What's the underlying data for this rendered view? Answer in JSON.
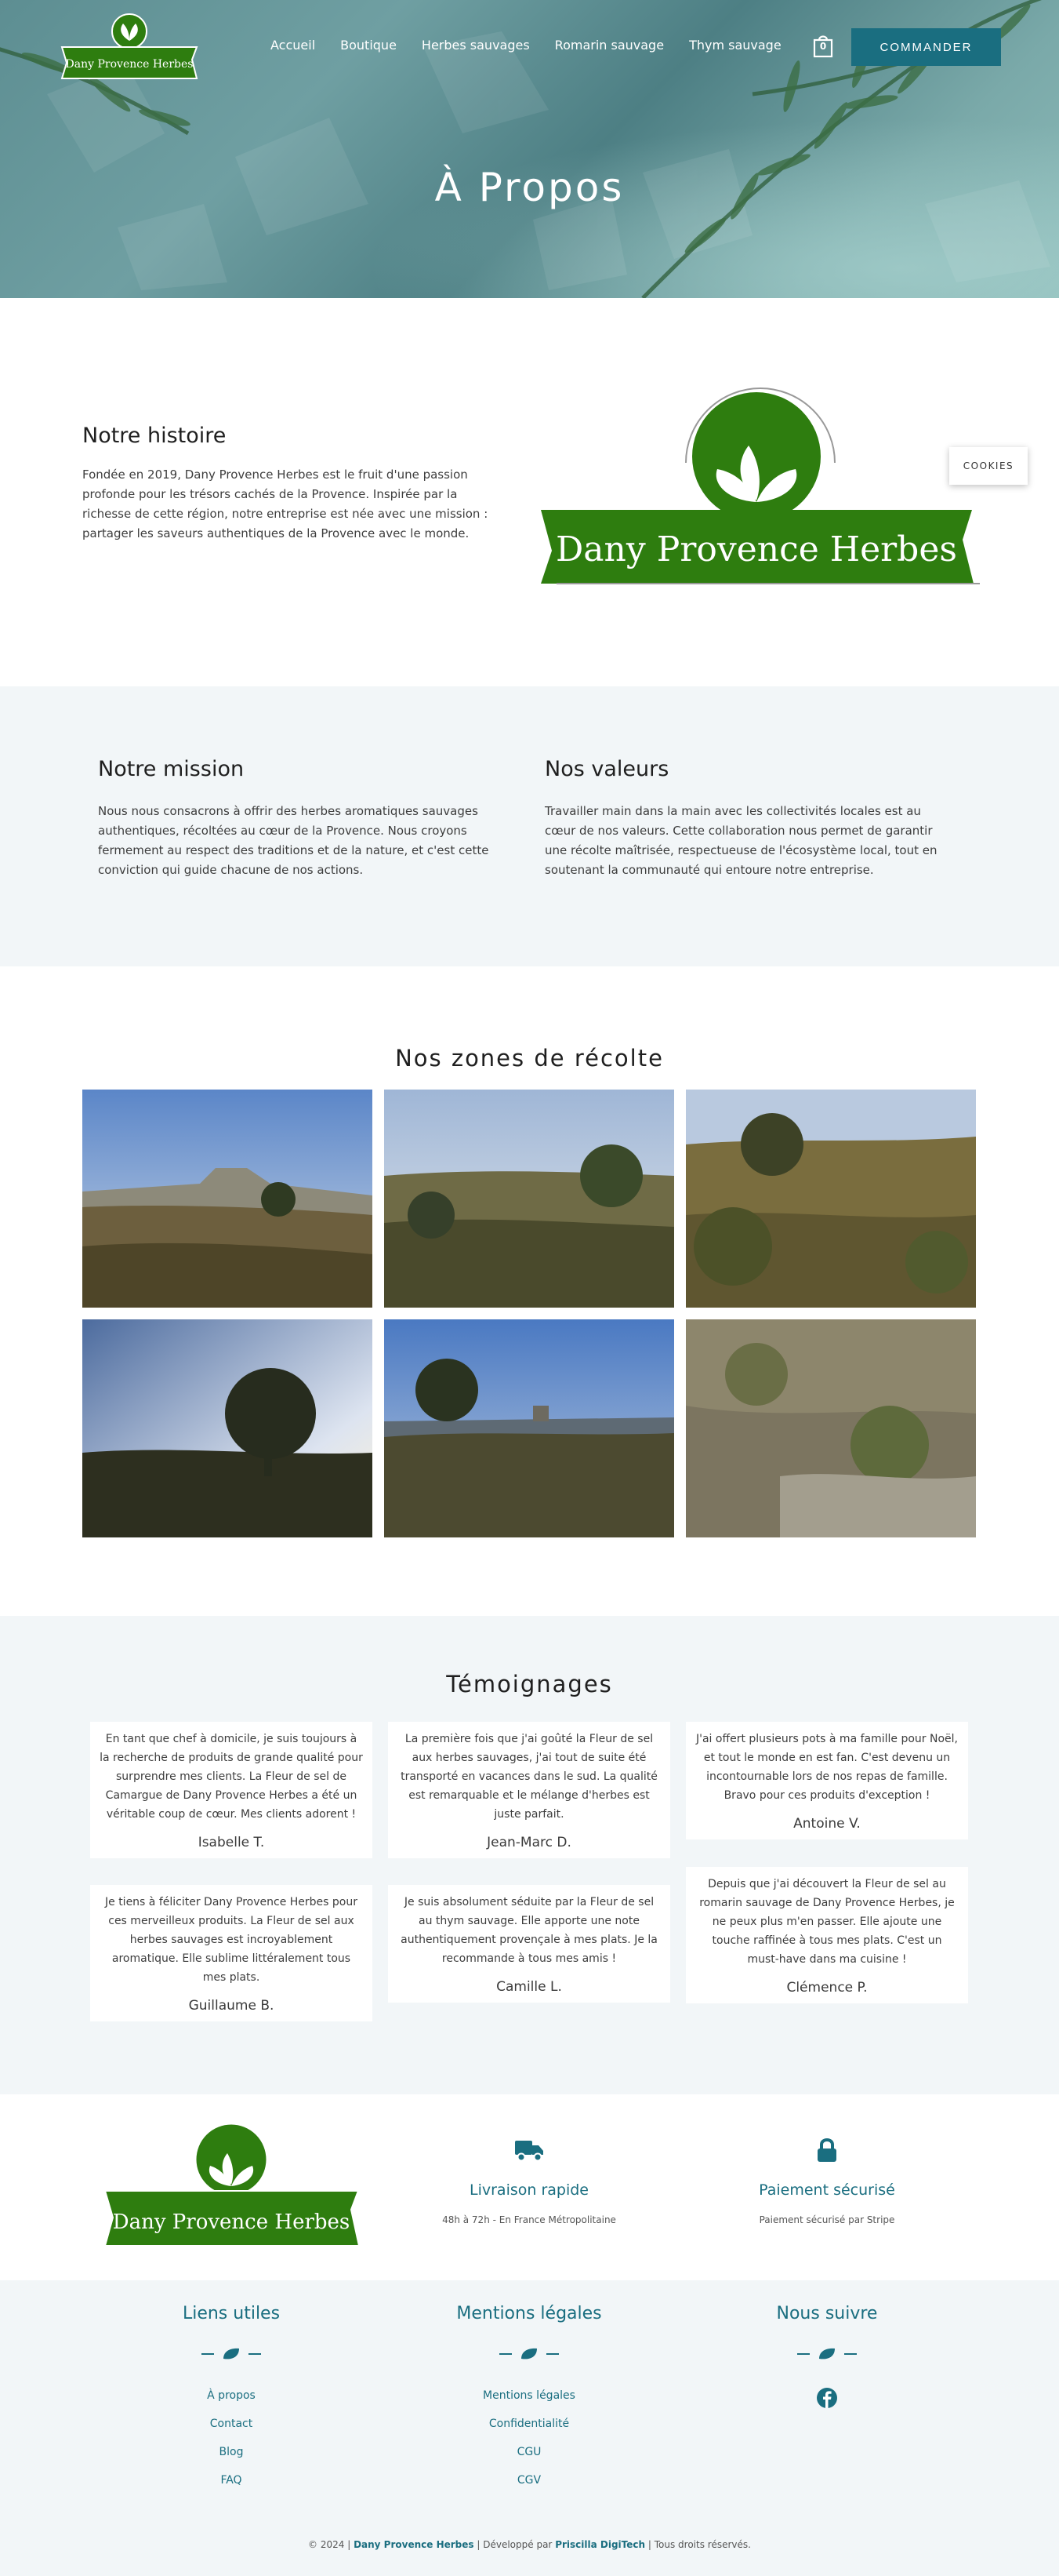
{
  "nav": {
    "logo_text": "Dany Provence Herbes",
    "links": [
      "Accueil",
      "Boutique",
      "Herbes sauvages",
      "Romarin sauvage",
      "Thym sauvage"
    ],
    "cart_count": "0",
    "order_button": "COMMANDER"
  },
  "hero": {
    "title": "À Propos"
  },
  "story": {
    "title": "Notre histoire",
    "text": "Fondée en 2019, Dany Provence Herbes est le fruit d'une passion profonde pour les trésors cachés de la Provence. Inspirée par la richesse de cette région, notre entreprise est née avec une mission : partager les saveurs authentiques de la Provence avec le monde.",
    "logo_text": "Dany Provence Herbes"
  },
  "cookies": {
    "label": "COOKIES"
  },
  "mission": {
    "title": "Notre mission",
    "text": "Nous nous consacrons à offrir des herbes aromatiques sauvages authentiques, récoltées au cœur de la Provence. Nous croyons fermement au respect des traditions et de la nature, et c'est cette conviction qui guide chacune de nos actions."
  },
  "values": {
    "title": "Nos valeurs",
    "text": "Travailler main dans la main avec les collectivités locales est au cœur de nos valeurs. Cette collaboration nous permet de garantir une récolte maîtrisée, respectueuse de l'écosystème local, tout en soutenant la communauté qui entoure notre entreprise."
  },
  "zones": {
    "title": "Nos zones de récolte"
  },
  "testimonials": {
    "title": "Témoignages",
    "items": [
      {
        "text": "En tant que chef à domicile, je suis toujours à la recherche de produits de grande qualité pour surprendre mes clients. La Fleur de sel de Camargue de Dany Provence Herbes a été un véritable coup de cœur. Mes clients adorent !",
        "author": "Isabelle T."
      },
      {
        "text": "La première fois que j'ai goûté la Fleur de sel aux herbes sauvages, j'ai tout de suite été transporté en vacances dans le sud. La qualité est remarquable et le mélange d'herbes est juste parfait.",
        "author": "Jean-Marc D."
      },
      {
        "text": "J'ai offert plusieurs pots à ma famille pour Noël, et tout le monde en est fan. C'est devenu un incontournable lors de nos repas de famille. Bravo pour ces produits d'exception !",
        "author": "Antoine V."
      },
      {
        "text": "Je tiens à féliciter Dany Provence Herbes pour ces merveilleux produits. La Fleur de sel aux herbes sauvages est incroyablement aromatique. Elle sublime littéralement tous mes plats.",
        "author": "Guillaume B."
      },
      {
        "text": "Je suis absolument séduite par la Fleur de sel au thym sauvage. Elle apporte une note authentiquement provençale à mes plats. Je la recommande à tous mes amis !",
        "author": "Camille L."
      },
      {
        "text": "Depuis que j'ai découvert la Fleur de sel au romarin sauvage de Dany Provence Herbes, je ne peux plus m'en passer. Elle ajoute une touche raffinée à tous mes plats. C'est un must-have dans ma cuisine !",
        "author": "Clémence P."
      }
    ]
  },
  "features": {
    "logo_text": "Dany Provence Herbes",
    "delivery": {
      "title": "Livraison rapide",
      "sub": "48h à 72h - En France Métropolitaine",
      "icon": "truck-icon"
    },
    "payment": {
      "title": "Paiement sécurisé",
      "sub": "Paiement sécurisé par Stripe",
      "icon": "lock-icon"
    }
  },
  "footer": {
    "useful": {
      "title": "Liens utiles",
      "links": [
        "À propos",
        "Contact",
        "Blog",
        "FAQ"
      ]
    },
    "legal": {
      "title": "Mentions légales",
      "links": [
        "Mentions légales",
        "Confidentialité",
        "CGU",
        "CGV"
      ]
    },
    "follow": {
      "title": "Nous suivre",
      "icon": "facebook-icon"
    },
    "copyright_pre": "© 2024 |",
    "brand": "Dany Provence Herbes",
    "copyright_mid": "| Développé par",
    "developer": "Priscilla DigiTech",
    "copyright_post": "| Tous droits réservés."
  },
  "colors": {
    "accent": "#1a6e80",
    "brand_green": "#2e7d0f",
    "light_bg": "#f2f6f8"
  }
}
